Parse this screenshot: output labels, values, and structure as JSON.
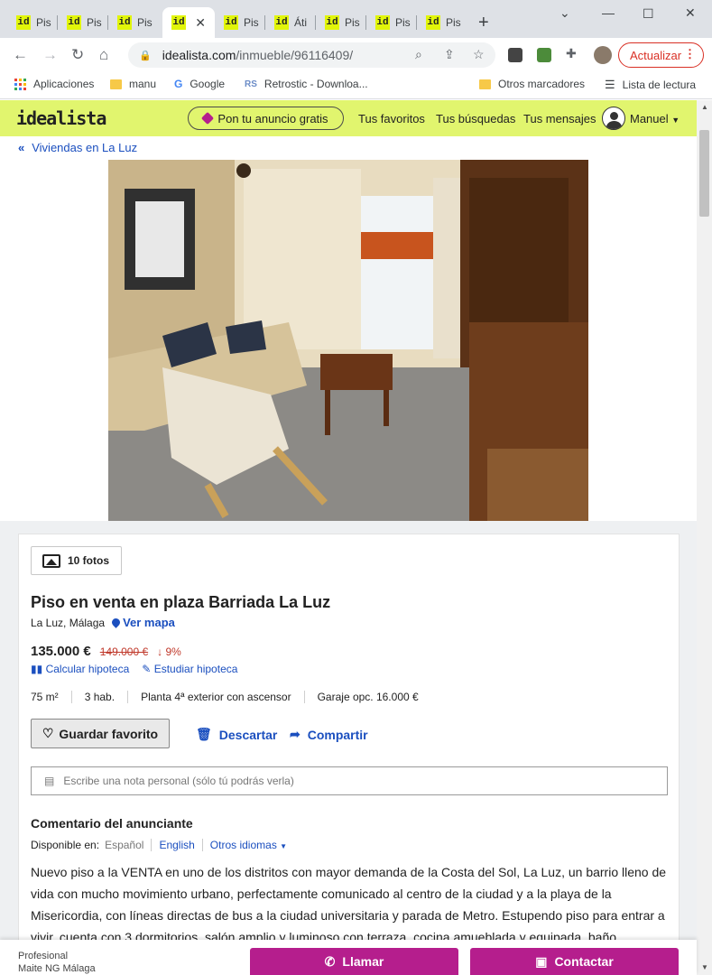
{
  "browser": {
    "tabs": [
      {
        "label": "Pis"
      },
      {
        "label": "Pis"
      },
      {
        "label": "Pis"
      },
      {
        "label": ""
      },
      {
        "label": "Pis"
      },
      {
        "label": "Áti"
      },
      {
        "label": "Pis"
      },
      {
        "label": "Pis"
      },
      {
        "label": "Pis"
      }
    ],
    "favicon_text": "id",
    "url_domain": "idealista.com",
    "url_path": "/inmueble/96116409/",
    "update_label": "Actualizar",
    "bookmarks": {
      "apps": "Aplicaciones",
      "manu": "manu",
      "google": "Google",
      "retrostic": "Retrostic - Downloa...",
      "otros": "Otros marcadores",
      "lectura": "Lista de lectura"
    }
  },
  "site": {
    "logo": "idealista",
    "publish": "Pon tu anuncio gratis",
    "favoritos": "Tus favoritos",
    "busquedas": "Tus búsquedas",
    "mensajes": "Tus mensajes",
    "user": "Manuel",
    "breadcrumb": "Viviendas en La Luz"
  },
  "listing": {
    "photos_count": "10 fotos",
    "title": "Piso en venta en plaza Barriada La Luz",
    "location": "La Luz, Málaga",
    "ver_mapa": "Ver mapa",
    "price": "135.000 €",
    "old_price": "149.000 €",
    "drop": "9%",
    "calcular": "Calcular hipoteca",
    "estudiar": "Estudiar hipoteca",
    "features": [
      "75 m²",
      "3 hab.",
      "Planta 4ª exterior con ascensor",
      "Garaje opc. 16.000 €"
    ],
    "guardar": "Guardar favorito",
    "descartar": "Descartar",
    "compartir": "Compartir",
    "note_placeholder": "Escribe una nota personal (sólo tú podrás verla)",
    "comment_title": "Comentario del anunciante",
    "available_in": "Disponible en:",
    "lang_es": "Español",
    "lang_en": "English",
    "lang_other": "Otros idiomas",
    "description": "Nuevo piso a la VENTA en uno de los distritos con mayor demanda de la Costa del Sol, La Luz, un barrio lleno de vida con mucho movimiento urbano, perfectamente comunicado al centro de la ciudad y a la playa de la Misericordia, con líneas directas de bus a la ciudad universitaria y parada de Metro. Estupendo piso para entrar a vivir, cuenta con 3 dormitorios, salón amplio y luminoso con terraza, cocina amueblada y equipada, baño completo, puertas y ventanas"
  },
  "footer": {
    "profesional": "Profesional",
    "agency": "Maite NG Málaga",
    "llamar": "Llamar",
    "contactar": "Contactar"
  }
}
